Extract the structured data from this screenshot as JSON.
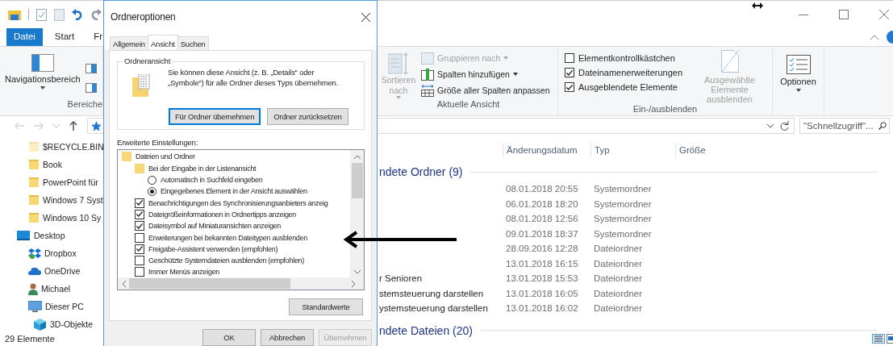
{
  "explorer": {
    "ribbon_tabs": [
      {
        "label": "Datei",
        "selected": true
      },
      {
        "label": "Start",
        "selected": false
      },
      {
        "label": "Fr",
        "selected": false
      }
    ],
    "ribbon": {
      "nav_group": {
        "button": "Navigationsbereich",
        "label": "Bereiche"
      },
      "view_group": {
        "label": "Aktuelle Ansicht",
        "sort_button": {
          "label": "Sortieren nach",
          "disabled": true
        },
        "commands": [
          {
            "label": "Gruppieren nach",
            "kind": "group",
            "disabled": true,
            "dropdown": true
          },
          {
            "label": "Spalten hinzufügen",
            "kind": "columns",
            "disabled": false,
            "dropdown": true
          },
          {
            "label": "Größe aller Spalten anpassen",
            "kind": "resize",
            "disabled": false,
            "dropdown": false
          }
        ]
      },
      "show_group": {
        "label": "Ein-/ausblenden",
        "checkboxes": [
          {
            "label": "Elementkontrollkästchen",
            "checked": false
          },
          {
            "label": "Dateinamenerweiterungen",
            "checked": true
          },
          {
            "label": "Ausgeblendete Elemente",
            "checked": true
          }
        ],
        "hide_button": {
          "label": "Ausgewählte Elemente ausblenden",
          "disabled": true
        }
      },
      "options_button": "Optionen"
    },
    "search": {
      "placeholder": "\"Schnellzugriff\"..."
    },
    "sidebar": {
      "quick_access": [
        {
          "label": "$RECYCLE.BIN",
          "kind": "folder-pale"
        },
        {
          "label": "Book",
          "kind": "folder"
        },
        {
          "label": "PowerPoint für",
          "kind": "folder"
        },
        {
          "label": "Windows 7 Syst",
          "kind": "folder"
        },
        {
          "label": "Windows 10 Sy",
          "kind": "folder"
        }
      ],
      "items": [
        {
          "label": "Desktop",
          "kind": "desktop",
          "children": [
            {
              "label": "Dropbox",
              "kind": "dropbox"
            },
            {
              "label": "OneDrive",
              "kind": "cloud"
            },
            {
              "label": "Michael",
              "kind": "user"
            },
            {
              "label": "Dieser PC",
              "kind": "pc",
              "children": [
                {
                  "label": "3D-Objekte",
                  "kind": "cube"
                }
              ]
            }
          ]
        }
      ]
    },
    "columns": [
      "Änderungsdatum",
      "Typ",
      "Größe"
    ],
    "groups": [
      {
        "title": "ndete Ordner (9)",
        "rows": [
          {
            "date": "08.01.2018 20:55",
            "type": "Systemordner"
          },
          {
            "date": "06.01.2018 18:20",
            "type": "Systemordner"
          },
          {
            "date": "08.01.2018 12:56",
            "type": "Systemordner"
          },
          {
            "date": "09.01.2018 18:37",
            "type": "Systemordner"
          },
          {
            "date": "28.09.2016 12:28",
            "type": "Dateiordner"
          },
          {
            "date": "13.01.2018 16:15",
            "type": "Dateiordner"
          },
          {
            "name": "r Senioren",
            "date": "13.01.2018 15:53",
            "type": "Dateiordner"
          },
          {
            "name": "stemsteuerung darstellen",
            "date": "13.01.2018 16:05",
            "type": "Dateiordner"
          },
          {
            "name": "ystemsteuerung darstellen",
            "date": "13.01.2018 16:02",
            "type": "Dateiordner"
          }
        ]
      },
      {
        "title": "ndete Dateien (20)"
      }
    ],
    "status": "29 Elemente"
  },
  "dialog": {
    "title": "Ordneroptionen",
    "tabs": [
      {
        "label": "Allgemein",
        "selected": false
      },
      {
        "label": "Ansicht",
        "selected": true
      },
      {
        "label": "Suchen",
        "selected": false
      }
    ],
    "folder_view": {
      "legend": "Ordneransicht",
      "text": "Sie können diese Ansicht (z. B. „Details“ oder „Symbole“) für alle Ordner dieses Typs übernehmen.",
      "buttons": [
        "Für Ordner übernehmen",
        "Ordner zurücksetzen"
      ]
    },
    "advanced": {
      "label": "Erweiterte Einstellungen:",
      "tree": [
        {
          "kind": "folder",
          "label": "Dateien und Ordner",
          "children": [
            {
              "kind": "folder",
              "label": "Bei der Eingabe in der Listenansicht",
              "children": [
                {
                  "kind": "radio",
                  "label": "Automatisch in Suchfeld eingeben",
                  "selected": false
                },
                {
                  "kind": "radio",
                  "label": "Eingegebenes Element in der Ansicht auswählen",
                  "selected": true
                }
              ]
            },
            {
              "kind": "checkbox",
              "label": "Benachrichtigungen des Synchronisierungsanbieters anzeig",
              "checked": true
            },
            {
              "kind": "checkbox",
              "label": "Dateigrößeinformationen in Ordnertipps anzeigen",
              "checked": true
            },
            {
              "kind": "checkbox",
              "label": "Dateisymbol auf Miniaturansichten anzeigen",
              "checked": true
            },
            {
              "kind": "checkbox",
              "label": "Erweiterungen bei bekannten Dateitypen ausblenden",
              "checked": false
            },
            {
              "kind": "checkbox",
              "label": "Freigabe-Assistent verwenden (empfohlen)",
              "checked": true
            },
            {
              "kind": "checkbox",
              "label": "Geschützte Systemdateien ausblenden (empfohlen)",
              "checked": false
            },
            {
              "kind": "checkbox",
              "label": "Immer Menüs anzeigen",
              "checked": false
            }
          ]
        }
      ]
    },
    "restore_button": "Standardwerte",
    "footer_buttons": [
      {
        "label": "OK",
        "disabled": false
      },
      {
        "label": "Abbrechen",
        "disabled": false
      },
      {
        "label": "Übernehmen",
        "disabled": true
      }
    ]
  }
}
